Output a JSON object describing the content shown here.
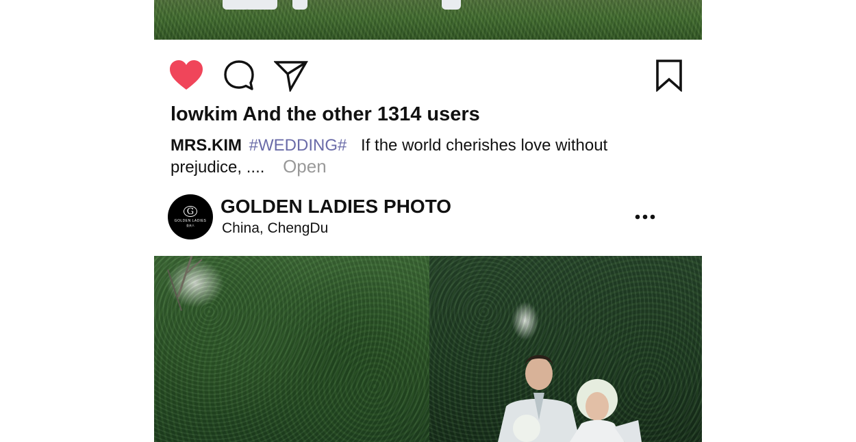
{
  "post": {
    "actions": {
      "like_icon": "heart-filled-icon",
      "comment_icon": "speech-bubble-icon",
      "share_icon": "paper-plane-icon",
      "save_icon": "bookmark-icon",
      "like_color": "#f0455a"
    },
    "likes_text": "lowkim And the other 1314 users",
    "caption": {
      "username": "MRS.KIM",
      "hashtag": "#WEDDING#",
      "text": "If the world cherishes love without prejudice, ....",
      "open_label": "Open"
    }
  },
  "next_post": {
    "account_name": "GOLDEN LADIES PHOTO",
    "location": "China,  ChengDu",
    "avatar": {
      "monogram": "G",
      "brand": "GOLDEN LADIES",
      "sub": "金夫人"
    },
    "more_icon": "more-horizontal-icon"
  },
  "colors": {
    "hashtag": "#6a6ba8",
    "open_link": "#999999",
    "text": "#111111"
  }
}
